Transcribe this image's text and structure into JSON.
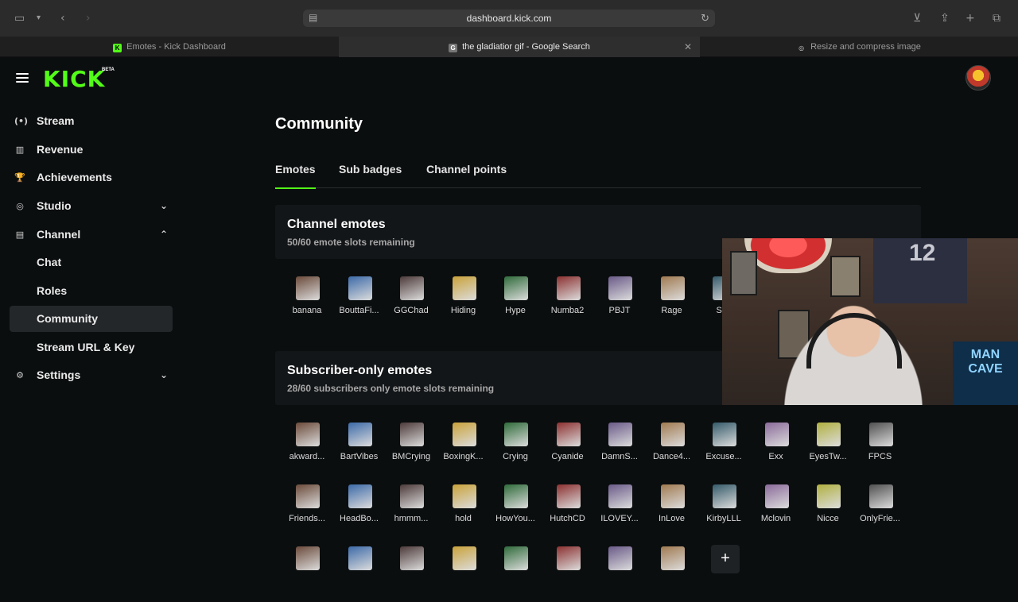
{
  "browser": {
    "url": "dashboard.kick.com",
    "tabs": [
      {
        "title": "Emotes - Kick Dashboard",
        "favicon": "K"
      },
      {
        "title": "the gladiatior gif - Google Search",
        "favicon": "G"
      },
      {
        "title": "Resize and compress image",
        "favicon": "◎"
      }
    ]
  },
  "app": {
    "logo": "KICK",
    "logo_badge": "BETA",
    "nav": [
      {
        "label": "Stream",
        "icon": "(•)"
      },
      {
        "label": "Revenue",
        "icon": "▥"
      },
      {
        "label": "Achievements",
        "icon": "🏆"
      },
      {
        "label": "Studio",
        "icon": "◎"
      },
      {
        "label": "Channel",
        "icon": "▤"
      },
      {
        "label": "Chat"
      },
      {
        "label": "Roles"
      },
      {
        "label": "Community"
      },
      {
        "label": "Stream URL & Key"
      },
      {
        "label": "Settings",
        "icon": "⚙"
      }
    ],
    "page_title": "Community",
    "page_tabs": [
      "Emotes",
      "Sub badges",
      "Channel points"
    ],
    "channel_emotes": {
      "title": "Channel emotes",
      "subtitle": "50/60 emote slots remaining",
      "items": [
        "banana",
        "BouttaFi...",
        "GGChad",
        "Hiding",
        "Hype",
        "Numba2",
        "PBJT",
        "Rage",
        "Sav"
      ]
    },
    "subscriber_emotes": {
      "title": "Subscriber-only emotes",
      "subtitle": "28/60 subscribers only emote slots remaining",
      "row1": [
        "akward...",
        "BartVibes",
        "BMCrying",
        "BoxingK...",
        "Crying",
        "Cyanide",
        "DamnS...",
        "Dance4...",
        "Excuse...",
        "Exx",
        "EyesTw...",
        "FPCS"
      ],
      "row2": [
        "Friends...",
        "HeadBo...",
        "hmmm...",
        "hold",
        "HowYou...",
        "HutchCD",
        "ILOVEY...",
        "InLove",
        "KirbyLLL",
        "Mclovin",
        "Nicce",
        "OnlyFrie..."
      ],
      "row3": [
        "",
        "",
        "",
        "",
        "",
        "",
        "",
        ""
      ]
    },
    "colors": {
      "accent": "#53fc18",
      "background": "#0b0e0f",
      "panel": "#131618"
    }
  },
  "webcam": {
    "sign_text": "MAN CAVE",
    "jersey_number": "12"
  }
}
